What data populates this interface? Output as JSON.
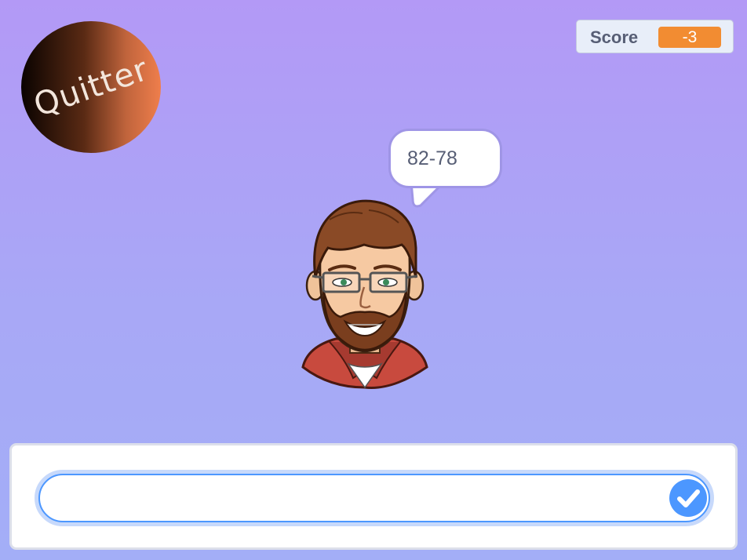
{
  "quitter": {
    "label": "Quitter"
  },
  "score_monitor": {
    "label": "Score",
    "value": "-3"
  },
  "speech_bubble": {
    "text": "82-78"
  },
  "ask_prompt": {
    "value": ""
  },
  "icons": {
    "submit": "check-icon",
    "avatar": "bitmoji-avatar"
  },
  "colors": {
    "stage_top": "#b399f6",
    "stage_bottom": "#a3aef7",
    "score_badge": "#f28c32",
    "accent_blue": "#4c97ff"
  }
}
